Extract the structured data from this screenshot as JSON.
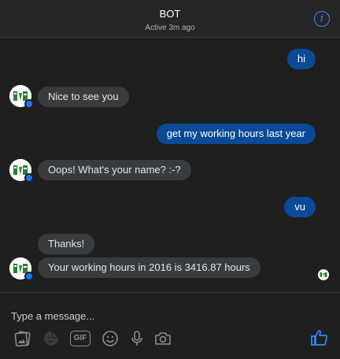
{
  "header": {
    "title": "BOT",
    "status": "Active 3m ago",
    "info_icon": "info-icon",
    "info_glyph": "i"
  },
  "messages": [
    {
      "sender": "user",
      "text": "hi"
    },
    {
      "sender": "bot",
      "text": "Nice to see you"
    },
    {
      "sender": "user",
      "text": "get my working hours last year"
    },
    {
      "sender": "bot",
      "text": "Oops! What's your name? :-?"
    },
    {
      "sender": "user",
      "text": "vu"
    },
    {
      "sender": "bot",
      "text": "Thanks!"
    },
    {
      "sender": "bot",
      "text": "Your working hours in 2016 is 3416.87 hours"
    }
  ],
  "composer": {
    "placeholder": "Type a message...",
    "gif_label": "GIF",
    "tools": [
      "image-icon",
      "sticker-icon",
      "gif-icon",
      "emoji-icon",
      "microphone-icon",
      "camera-icon",
      "like-icon"
    ]
  },
  "colors": {
    "outgoing_bubble": "#0a4a96",
    "incoming_bubble": "#3a3b3c",
    "accent": "#2f8cff",
    "background": "#1f1f1f"
  }
}
